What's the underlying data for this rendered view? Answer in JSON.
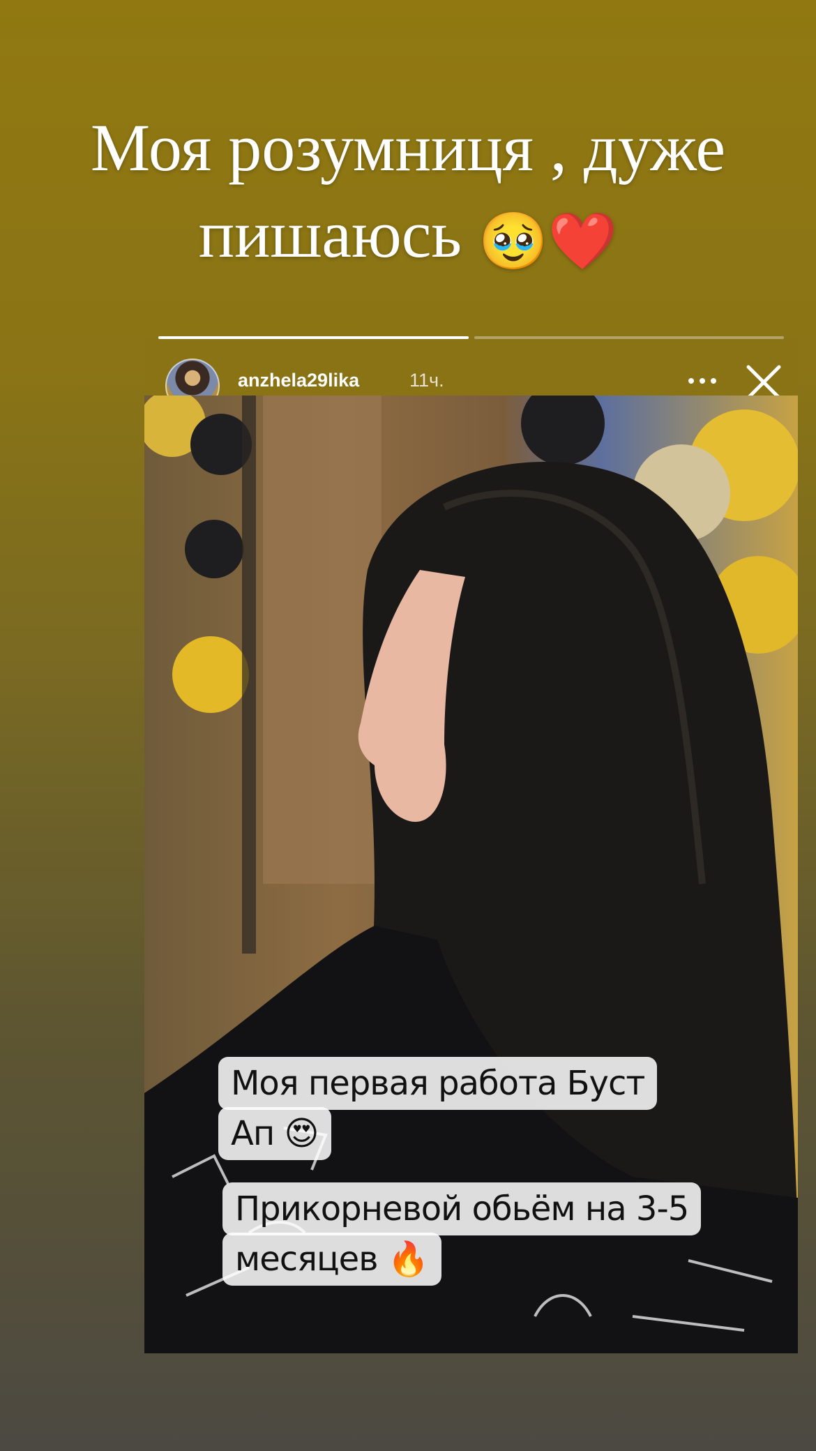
{
  "headline": {
    "line1": "Моя розумниця , дуже",
    "line2": "пишаюсь",
    "emojis": "🥹❤️"
  },
  "story": {
    "progress": [
      1.0,
      0.0
    ],
    "username": "anzhela29lika",
    "time_ago": "11ч.",
    "more_icon": "more-horizontal-icon",
    "close_icon": "close-x-icon",
    "caption1_line1": "Моя первая работа Буст",
    "caption1_line2": "Ап 😍",
    "caption2_line1": "Прикорневой обьём на 3-5",
    "caption2_line2": "месяцев 🔥"
  }
}
